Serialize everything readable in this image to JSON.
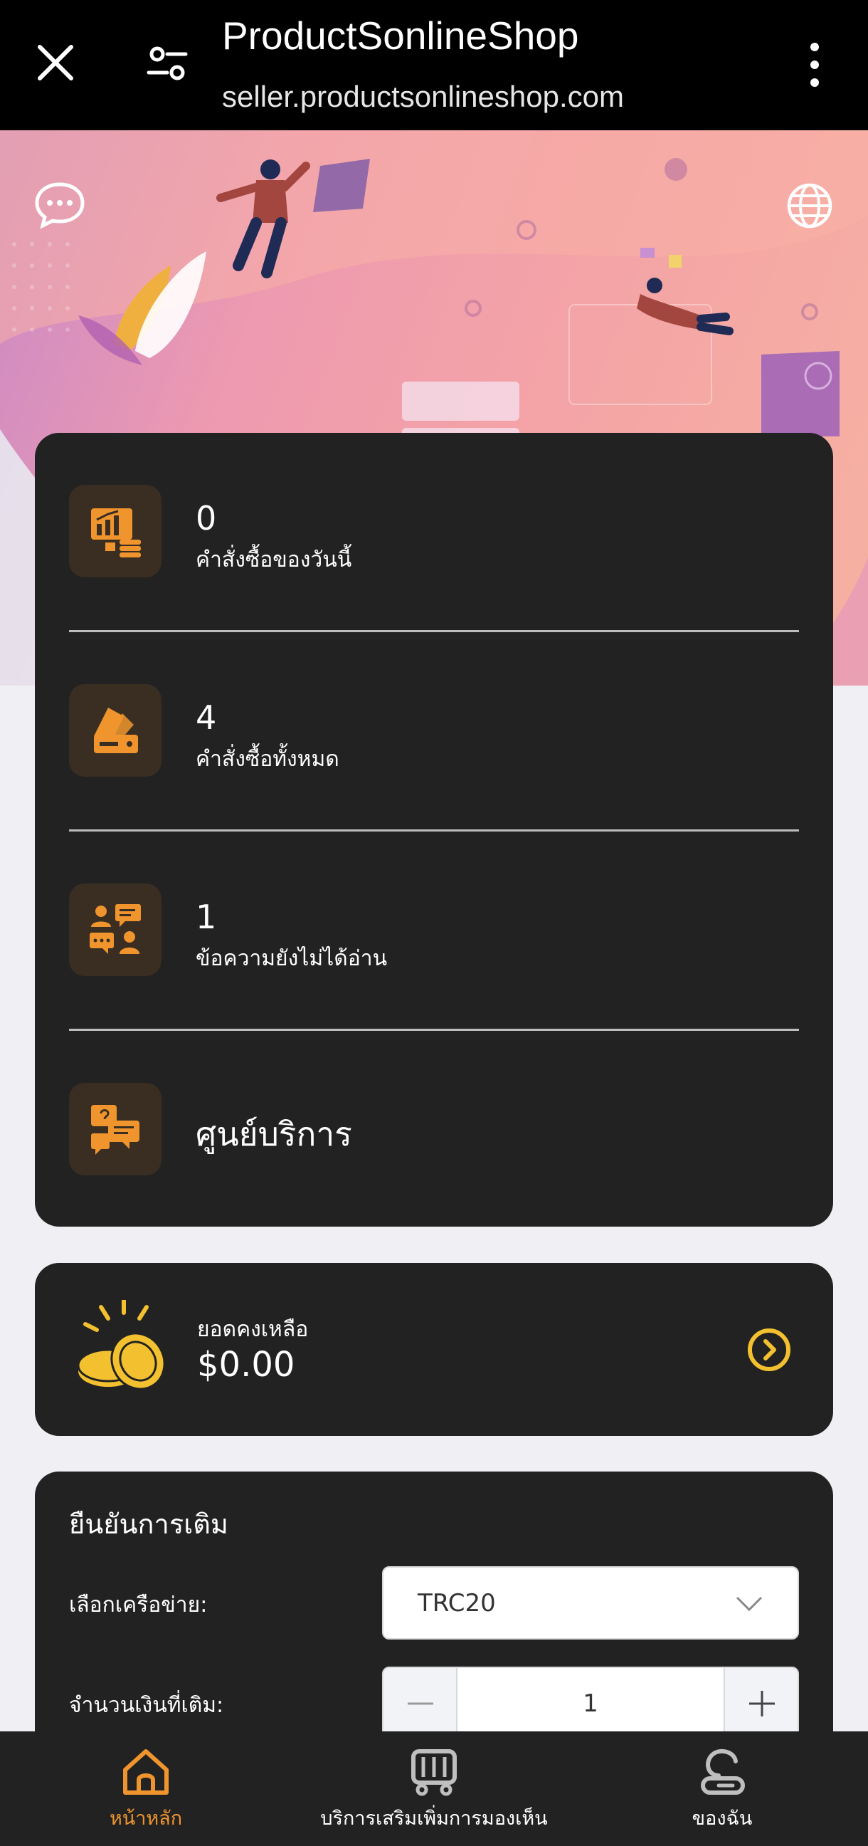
{
  "browser": {
    "title": "ProductSonlineShop",
    "url": "seller.productsonlineshop.com"
  },
  "stats": [
    {
      "value": "0",
      "label": "คำสั่งซื้อของวันนี้",
      "icon": "chart-screen-icon"
    },
    {
      "value": "4",
      "label": "คำสั่งซื้อทั้งหมด",
      "icon": "cards-icon"
    },
    {
      "value": "1",
      "label": "ข้อความยังไม่ได้อ่าน",
      "icon": "users-chat-icon"
    }
  ],
  "service": {
    "label": "ศูนย์บริการ",
    "icon": "service-chat-icon"
  },
  "balance": {
    "label": "ยอดคงเหลือ",
    "amount": "$0.00"
  },
  "topup": {
    "title": "ยืนยันการเติม",
    "network_label": "เลือกเครือข่าย:",
    "network_value": "TRC20",
    "amount_label": "จำนวนเงินที่เติม:",
    "amount_value": "1"
  },
  "nav": {
    "home": "หน้าหลัก",
    "services": "บริการเสริมเพิ่มการมองเห็น",
    "mine": "ของฉัน"
  },
  "colors": {
    "accent": "#f0952e",
    "card": "#222222",
    "coin": "#f3c02f"
  }
}
